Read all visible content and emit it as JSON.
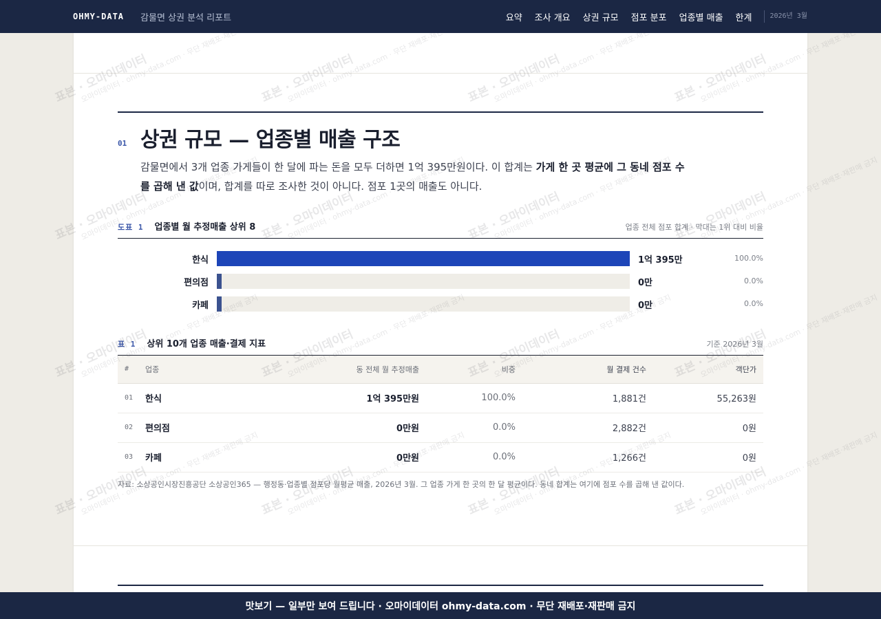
{
  "header": {
    "brand": "OHMY-DATA",
    "title": "감물면 상권 분석 리포트",
    "nav": [
      "요약",
      "조사 개요",
      "상권 규모",
      "점포 분포",
      "업종별 매출",
      "한계"
    ],
    "date": "2026년 3월"
  },
  "section": {
    "number": "01",
    "title": "상권 규모 — 업종별 매출 구조",
    "lead_1": "감물면에서 3개 업종 가게들이 한 달에 파는 돈을 모두 더하면 1억 395만원이다. 이 합계는 ",
    "lead_bold": "가게 한 곳 평균에 그 동네 점포 수를 곱해 낸 값",
    "lead_2": "이며, 합계를 따로 조사한 것이 아니다. 점포 1곳의 매출도 아니다."
  },
  "figure": {
    "tag": "도표 1",
    "title": "업종별 월 추정매출 상위 8",
    "note": "업종 전체 점포 합계 · 막대는 1위 대비 비율",
    "bars": [
      {
        "label": "한식",
        "value": "1억 395만",
        "pct": "100.0%",
        "ratio": 1.0
      },
      {
        "label": "편의점",
        "value": "0만",
        "pct": "0.0%",
        "ratio": 0.0
      },
      {
        "label": "카페",
        "value": "0만",
        "pct": "0.0%",
        "ratio": 0.0
      }
    ]
  },
  "table": {
    "tag": "표 1",
    "title": "상위 10개 업종 매출·결제 지표",
    "note": "기준 2026년 3월",
    "headers": [
      "#",
      "업종",
      "동 전체 월 추정매출",
      "비중",
      "월 결제 건수",
      "객단가"
    ],
    "rows": [
      {
        "no": "01",
        "name": "한식",
        "sales": "1억 395만원",
        "share": "100.0%",
        "count": "1,881건",
        "avg": "55,263원"
      },
      {
        "no": "02",
        "name": "편의점",
        "sales": "0만원",
        "share": "0.0%",
        "count": "2,882건",
        "avg": "0원"
      },
      {
        "no": "03",
        "name": "카페",
        "sales": "0만원",
        "share": "0.0%",
        "count": "1,266건",
        "avg": "0원"
      }
    ]
  },
  "source": "자료: 소상공인시장진흥공단 소상공인365 — 행정동·업종별 점포당 월평균 매출, 2026년 3월. 그 업종 가게 한 곳의 한 달 평균이다. 동네 합계는 여기에 점포 수를 곱해 낸 값이다.",
  "watermark": {
    "primary": "표본 · 오마이데이터",
    "secondary": "오마이데이터 · ohmy-data.com · 무단 재배포·재판매 금지"
  },
  "footer": "맛보기 — 일부만 보여 드립니다 · 오마이데이터 ohmy-data.com · 무단 재배포·재판매 금지",
  "colors": {
    "navy": "#1b2744",
    "bar": "#1d45b8",
    "accent": "#3a56a8"
  }
}
